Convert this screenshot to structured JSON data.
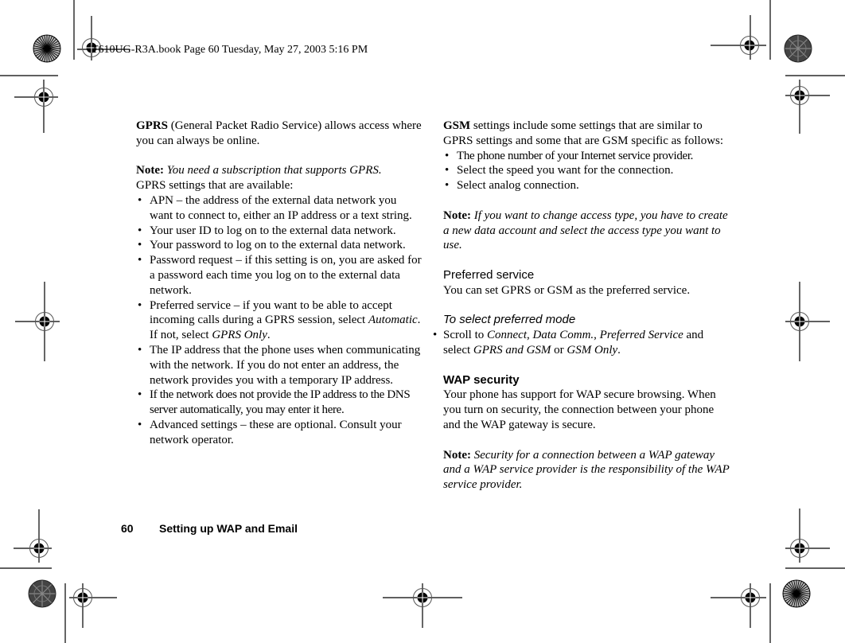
{
  "print_header": "T610UG-R3A.book  Page 60  Tuesday, May 27, 2003  5:16 PM",
  "left_column": {
    "intro": {
      "bold": "GPRS",
      "rest": " (General Packet Radio Service) allows access where you can always be online."
    },
    "note": {
      "label": "Note:",
      "text": "You need a subscription that supports GPRS."
    },
    "settings_intro": "GPRS settings that are available:",
    "bullets": [
      "APN – the address of the external data network you want to connect to, either an IP address or a text string.",
      "Your user ID to log on to the external data network.",
      "Your password to log on to the external data network.",
      "Password request – if this setting is on, you are asked for a password each time you log on to the external data network.",
      {
        "pre": "Preferred service – if you want to be able to accept incoming calls during a GPRS session, select ",
        "ital1": "Automatic",
        "mid": ". If not, select ",
        "ital2": "GPRS Only",
        "post": "."
      },
      "The IP address that the phone uses when communicating with the network. If you do not enter an address, the network provides you with a temporary IP address.",
      "If the network does not provide the IP address to the DNS server automatically, you may enter it here.",
      "Advanced settings – these are optional. Consult your network operator."
    ]
  },
  "right_column": {
    "intro": {
      "bold": "GSM",
      "rest": " settings include some settings that are similar to GPRS settings and some that are GSM specific as follows:"
    },
    "bullets": [
      "The phone number of your Internet service provider.",
      "Select the speed you want for the connection.",
      "Select analog connection."
    ],
    "note1": {
      "label": "Note:",
      "text": "If you want to change access type, you have to create a new data account and select the access type you want to use."
    },
    "preferred_heading": "Preferred service",
    "preferred_text": "You can set GPRS or GSM as the preferred service.",
    "procedure_heading": "To select preferred mode",
    "procedure_step": {
      "a": "Scroll to ",
      "b": "Connect",
      "c": ", ",
      "d": "Data Comm.",
      "e": ", ",
      "f": "Preferred Service",
      "g": " and select ",
      "h": "GPRS and GSM",
      "i": " or ",
      "j": "GSM Only",
      "k": "."
    },
    "wap_heading": "WAP security",
    "wap_text": "Your phone has support for WAP secure browsing. When you turn on security, the connection between your phone and the WAP gateway is secure.",
    "note2": {
      "label": "Note:",
      "text": "Security for a connection between a WAP gateway and a WAP service provider is the responsibility of the WAP service provider."
    }
  },
  "footer": {
    "page_number": "60",
    "section": "Setting up WAP and Email"
  },
  "bullet_glyph": "•"
}
